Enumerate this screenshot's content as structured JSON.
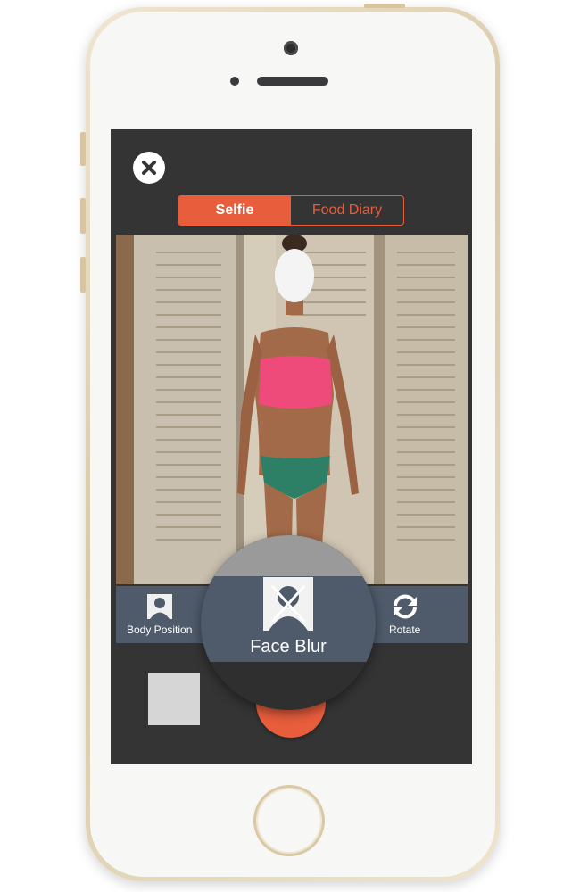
{
  "app": {
    "tabs": [
      {
        "label": "Selfie",
        "active": true
      },
      {
        "label": "Food Diary",
        "active": false
      }
    ]
  },
  "toolbar": {
    "body_position_label": "Body Position",
    "face_blur_label": "Face Blur",
    "rotate_label": "Rotate"
  },
  "icons": {
    "close": "close-icon",
    "body_position": "person-silhouette-icon",
    "face_blur": "face-blur-icon",
    "rotate": "rotate-icon"
  },
  "colors": {
    "accent": "#e85d3c",
    "toolbar": "#4f5b6b",
    "screen_bg": "#343434"
  }
}
